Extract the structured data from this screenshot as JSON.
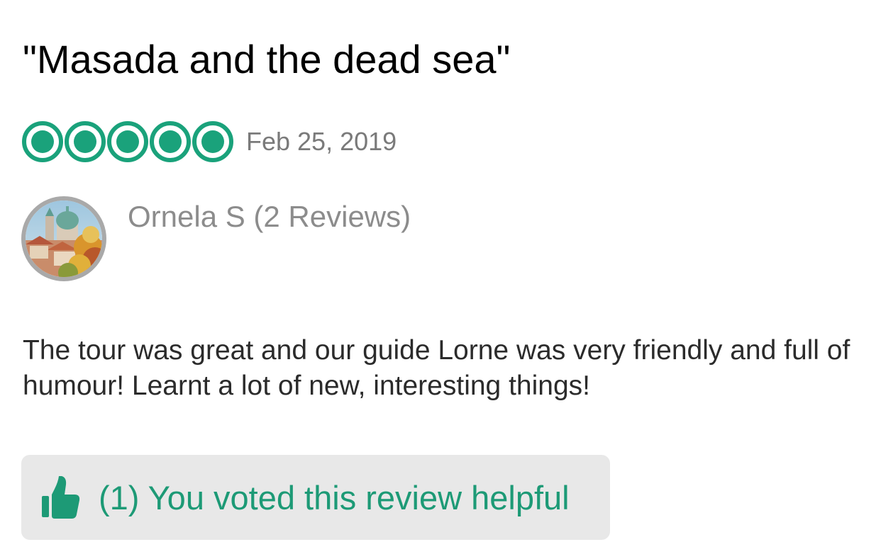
{
  "review": {
    "title": "\"Masada and the dead sea\"",
    "rating": {
      "value": 5,
      "max": 5,
      "icon": "circle-bubble-icon",
      "color": "#1aa27b"
    },
    "date": "Feb 25, 2019",
    "author": "Ornela S (2 Reviews)",
    "avatar_icon": "user-avatar-photo",
    "body": "The tour was great and our guide Lorne was very friendly and full of humour! Learnt a lot of new, interesting things!",
    "helpful": {
      "label": "(1) You voted this review helpful",
      "icon": "thumbs-up-icon",
      "color": "#1d9a76",
      "background": "#e8e8e8"
    }
  }
}
